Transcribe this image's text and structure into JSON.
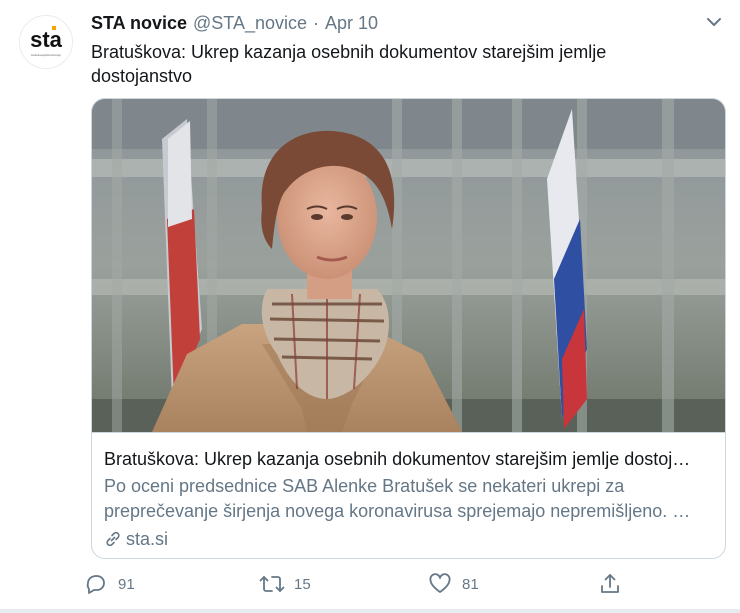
{
  "tweet": {
    "display_name": "STA novice",
    "handle": "@STA_novice",
    "separator": "·",
    "date": "Apr 10",
    "text": "Bratuškova: Ukrep kazanja osebnih dokumentov starejšim jemlje dostojanstvo",
    "avatar_logo_text": "sta",
    "avatar_logo_caption": "Slovenska tiskovna agencija Slovenian Press Agency"
  },
  "card": {
    "title": "Bratuškova: Ukrep kazanja osebnih dokumentov starejšim jemlje dostoj…",
    "description": "Po oceni predsednice SAB Alenke Bratušek se nekateri ukrepi za preprečevanje širjenja novega koronavirusa sprejemajo nepremišljeno. …",
    "domain": "sta.si"
  },
  "actions": {
    "reply_count": "91",
    "retweet_count": "15",
    "like_count": "81"
  },
  "colors": {
    "text_primary": "#14171a",
    "text_secondary": "#657786",
    "border": "#ccd6dd",
    "logo_accent": "#f5a500"
  }
}
